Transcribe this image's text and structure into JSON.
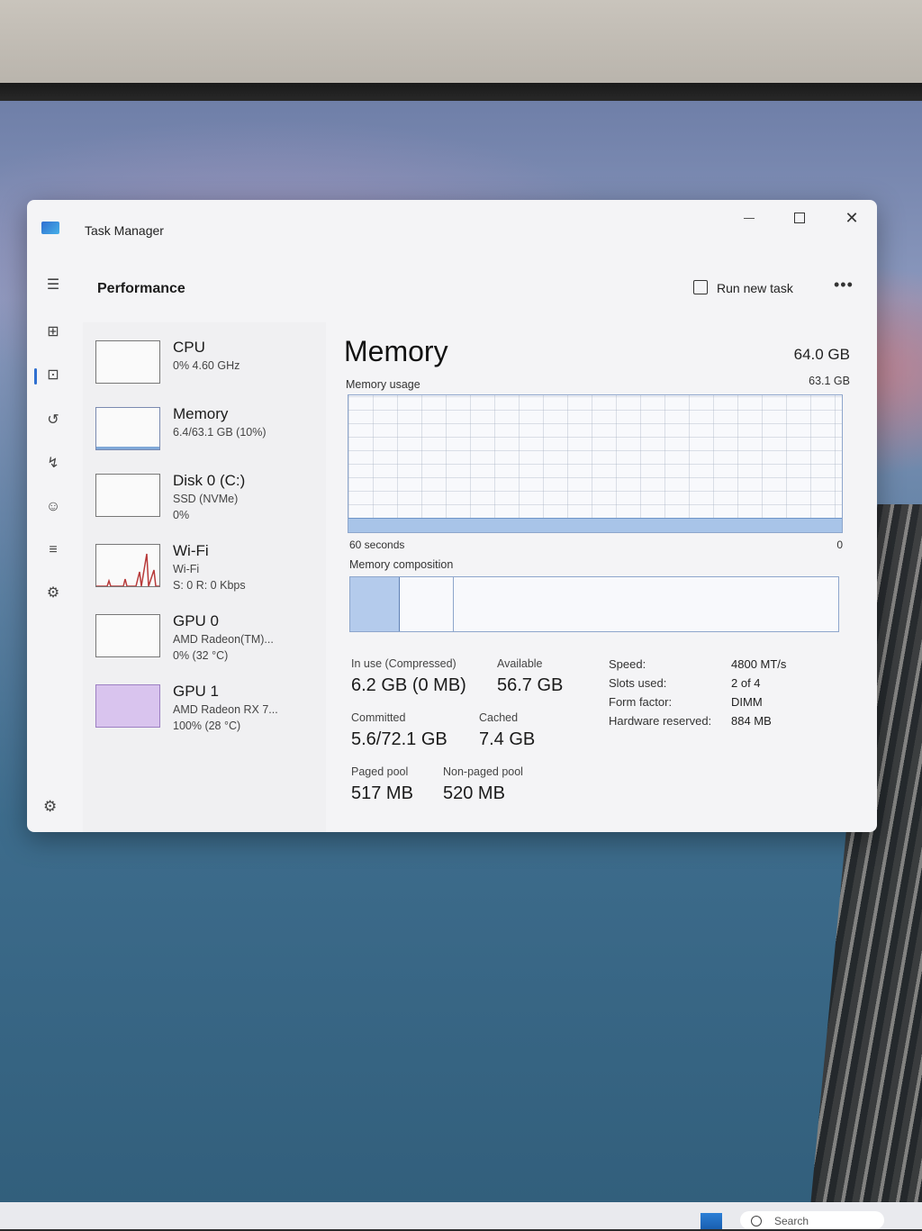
{
  "taskbar": {
    "search_placeholder": "Search"
  },
  "window": {
    "title": "Task Manager",
    "close_glyph": "✕",
    "more_glyph": "•••"
  },
  "header": {
    "page_title": "Performance",
    "run_new_task": "Run new task"
  },
  "nav": {
    "icons": [
      "hamburger-icon",
      "processes-icon",
      "performance-icon",
      "app-history-icon",
      "startup-apps-icon",
      "users-icon",
      "details-icon",
      "services-icon",
      "settings-icon"
    ],
    "glyphs": {
      "menu": "☰",
      "processes": "⊞",
      "performance": "⊡",
      "history": "↺",
      "startup": "↯",
      "users": "☺",
      "details": "≡",
      "services": "⚙",
      "settings": "⚙"
    }
  },
  "devices": [
    {
      "name": "CPU",
      "line1": "0% 4.60 GHz",
      "line2": ""
    },
    {
      "name": "Memory",
      "line1": "6.4/63.1 GB (10%)",
      "line2": ""
    },
    {
      "name": "Disk 0 (C:)",
      "line1": "SSD (NVMe)",
      "line2": "0%"
    },
    {
      "name": "Wi-Fi",
      "line1": "Wi-Fi",
      "line2": "S: 0 R: 0 Kbps"
    },
    {
      "name": "GPU 0",
      "line1": "AMD Radeon(TM)...",
      "line2": "0% (32 °C)"
    },
    {
      "name": "GPU 1",
      "line1": "AMD Radeon RX 7...",
      "line2": "100% (28 °C)"
    }
  ],
  "memory": {
    "title": "Memory",
    "total": "64.0 GB",
    "usage_label": "Memory usage",
    "usage_max": "63.1 GB",
    "usage_fraction": 0.1,
    "axis_left": "60 seconds",
    "axis_right": "0",
    "composition_label": "Memory composition",
    "composition": {
      "in_use_fraction": 0.1,
      "standby_fraction": 0.21
    },
    "stats": {
      "in_use_label": "In use (Compressed)",
      "in_use_value": "6.2 GB (0 MB)",
      "available_label": "Available",
      "available_value": "56.7 GB",
      "committed_label": "Committed",
      "committed_value": "5.6/72.1 GB",
      "cached_label": "Cached",
      "cached_value": "7.4 GB",
      "paged_label": "Paged pool",
      "paged_value": "517 MB",
      "nonpaged_label": "Non-paged pool",
      "nonpaged_value": "520 MB"
    },
    "specs": [
      {
        "key": "Speed:",
        "value": "4800 MT/s"
      },
      {
        "key": "Slots used:",
        "value": "2 of 4"
      },
      {
        "key": "Form factor:",
        "value": "DIMM"
      },
      {
        "key": "Hardware reserved:",
        "value": "884 MB"
      }
    ]
  },
  "colors": {
    "accent": "#2f6fd0",
    "memory_fill": "#a8c4e8",
    "gpu1_fill": "#d9c4ee"
  }
}
